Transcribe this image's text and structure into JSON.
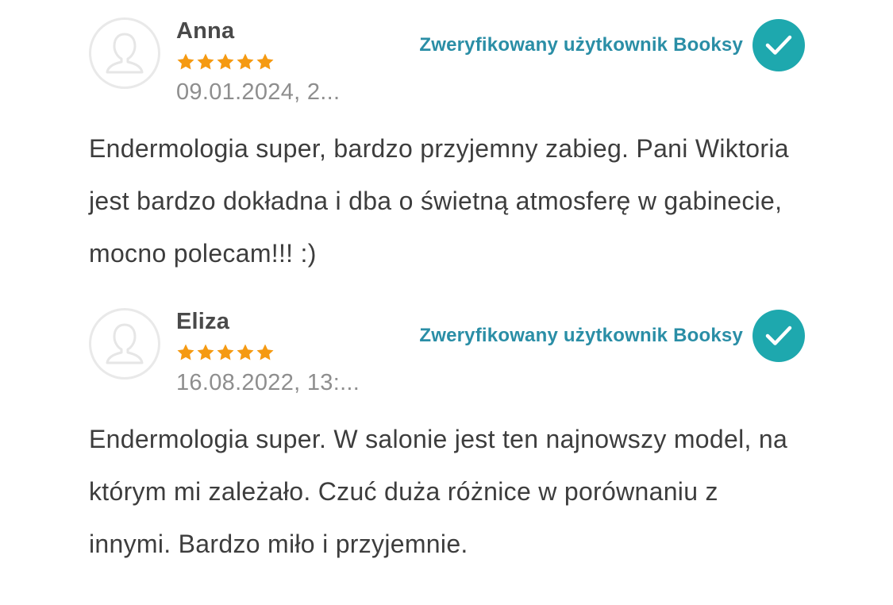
{
  "colors": {
    "accent": "#2a8ea6",
    "badge": "#1ea8ae",
    "star": "#f59a12",
    "text": "#3d3d3d",
    "muted": "#8e8e8e"
  },
  "reviews": [
    {
      "author": "Anna",
      "rating": 5,
      "date": "09.01.2024, 2...",
      "verified_label": "Zweryfikowany użytkownik Booksy",
      "text": "Endermologia super, bardzo przyjemny zabieg. Pani Wiktoria jest bardzo dokładna i dba o świetną atmosferę w gabinecie, mocno polecam!!! :)",
      "avatar_icon": "user-placeholder-icon",
      "badge_icon": "checkmark-icon"
    },
    {
      "author": "Eliza",
      "rating": 5,
      "date": "16.08.2022, 13:...",
      "verified_label": "Zweryfikowany użytkownik Booksy",
      "text": "Endermologia super. W salonie jest ten najnowszy model, na którym mi zależało. Czuć duża różnice w porównaniu z innymi. Bardzo miło i przyjemnie.",
      "avatar_icon": "user-placeholder-icon",
      "badge_icon": "checkmark-icon"
    }
  ]
}
